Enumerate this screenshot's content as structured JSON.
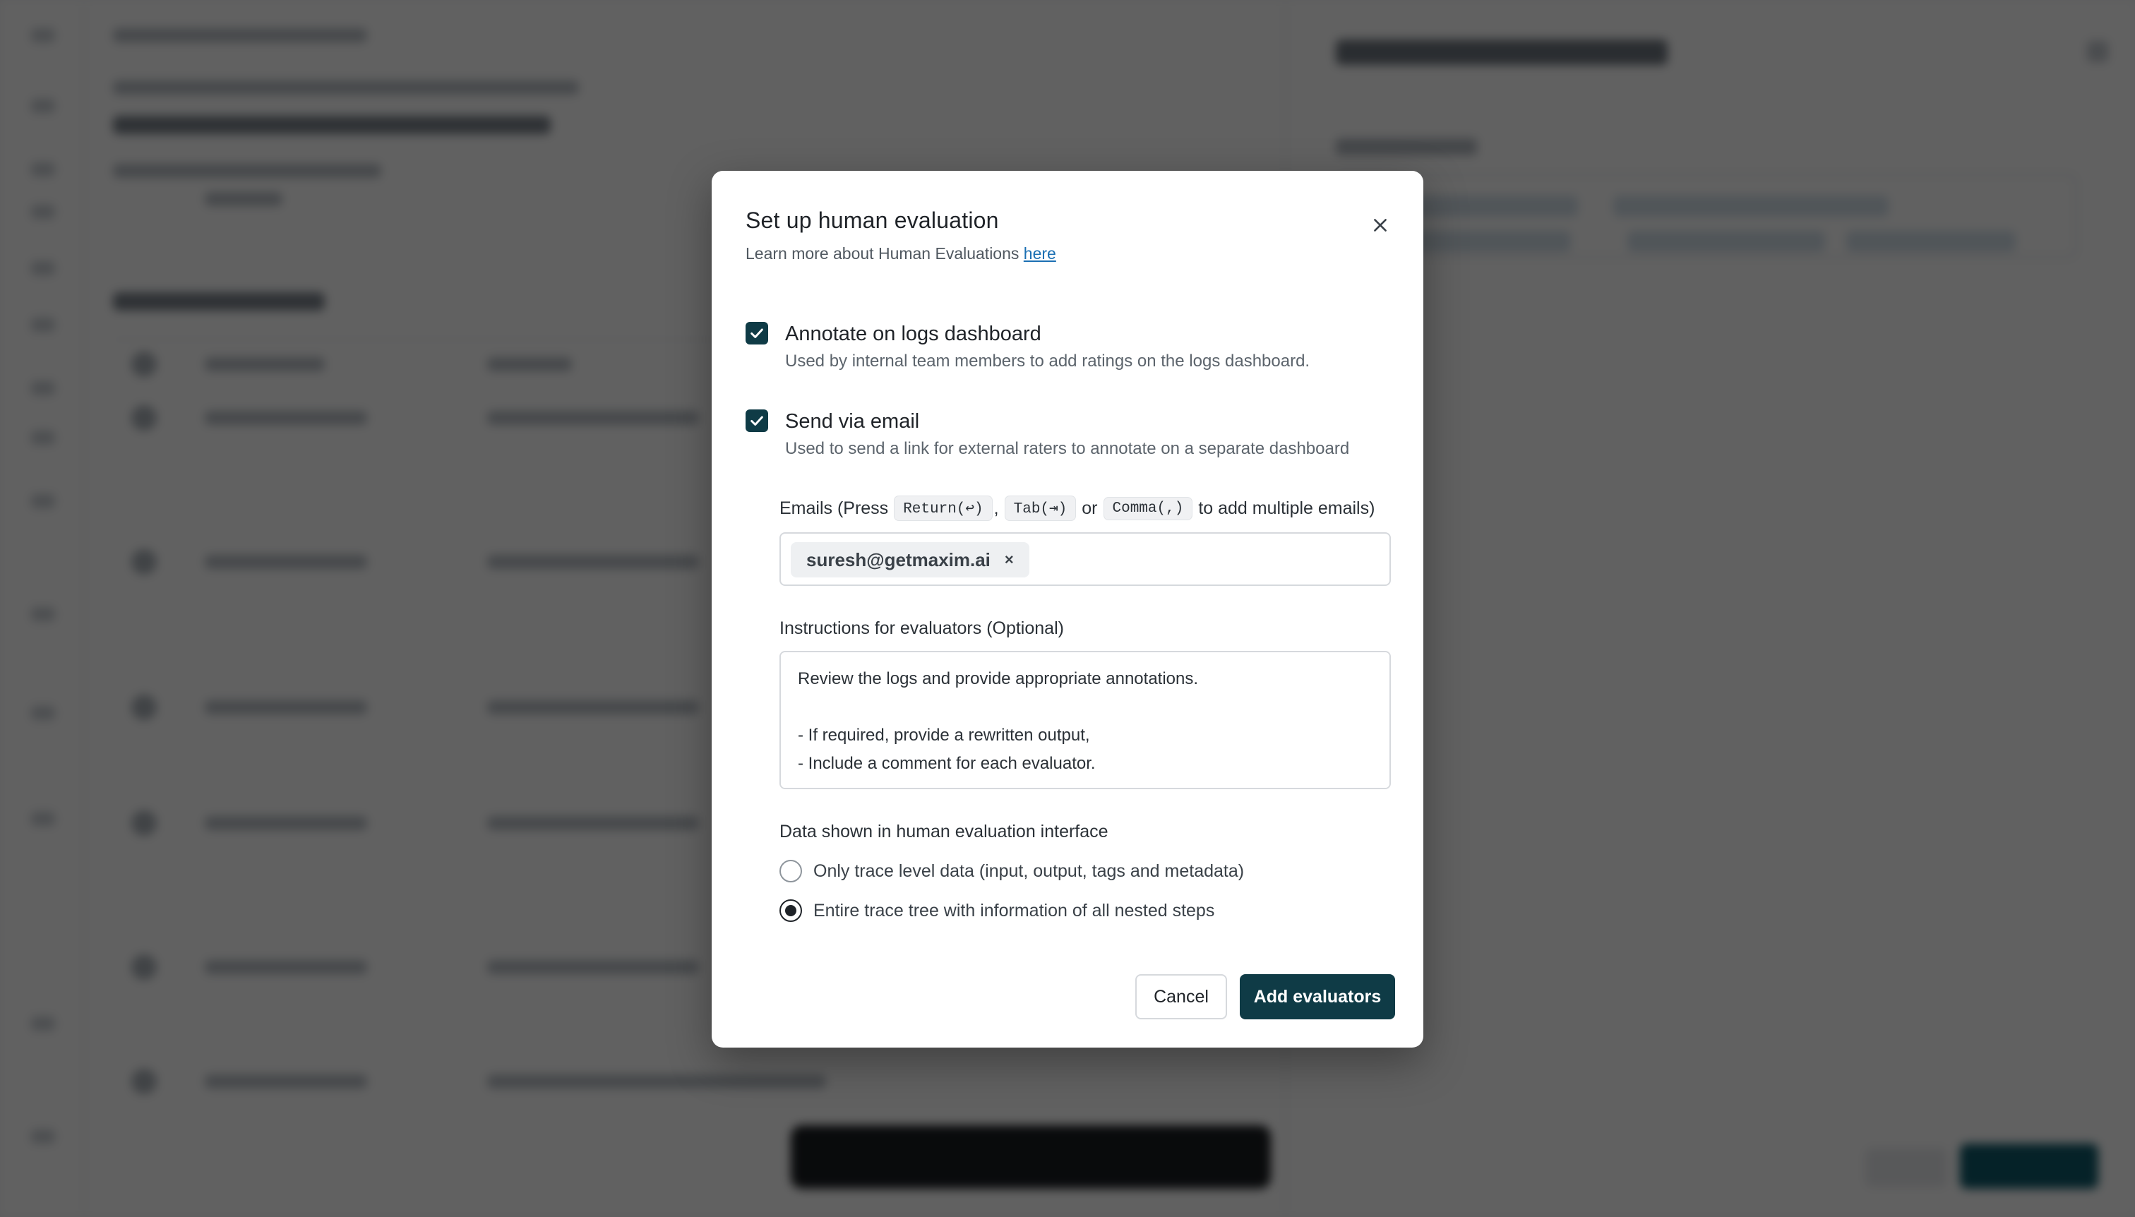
{
  "modal": {
    "title": "Set up human evaluation",
    "subtitle": "Learn more about Human Evaluations",
    "subtitle_link": "here",
    "close_icon": "close-icon",
    "options": [
      {
        "label": "Annotate on logs dashboard",
        "description": "Used by internal team members to add ratings on the logs dashboard.",
        "checked": true
      },
      {
        "label": "Send via email",
        "description": "Used to send a link for external raters to annotate on a separate dashboard",
        "checked": true
      }
    ],
    "emails": {
      "label_prefix": "Emails (Press",
      "keys": [
        "Return(↩)",
        "Tab(⇥)",
        "Comma(,)"
      ],
      "sep_comma": ",",
      "sep_or": "or",
      "label_suffix": "to add multiple emails)",
      "chips": [
        "suresh@getmaxim.ai"
      ],
      "chip_remove": "×"
    },
    "instructions": {
      "label": "Instructions for evaluators (Optional)",
      "value": "Review the logs and provide appropriate annotations.\n\n- If required, provide a rewritten output,\n- Include a comment for each evaluator."
    },
    "data_shown": {
      "label": "Data shown in human evaluation interface",
      "options": [
        "Only trace level data (input, output, tags and metadata)",
        "Entire trace tree with information of all nested steps"
      ],
      "selected_index": 1
    },
    "buttons": {
      "cancel": "Cancel",
      "confirm": "Add evaluators"
    }
  },
  "colors": {
    "primary": "#0f3b46",
    "link": "#1b6fb3",
    "overlay": "rgba(0,0,0,0.62)"
  }
}
